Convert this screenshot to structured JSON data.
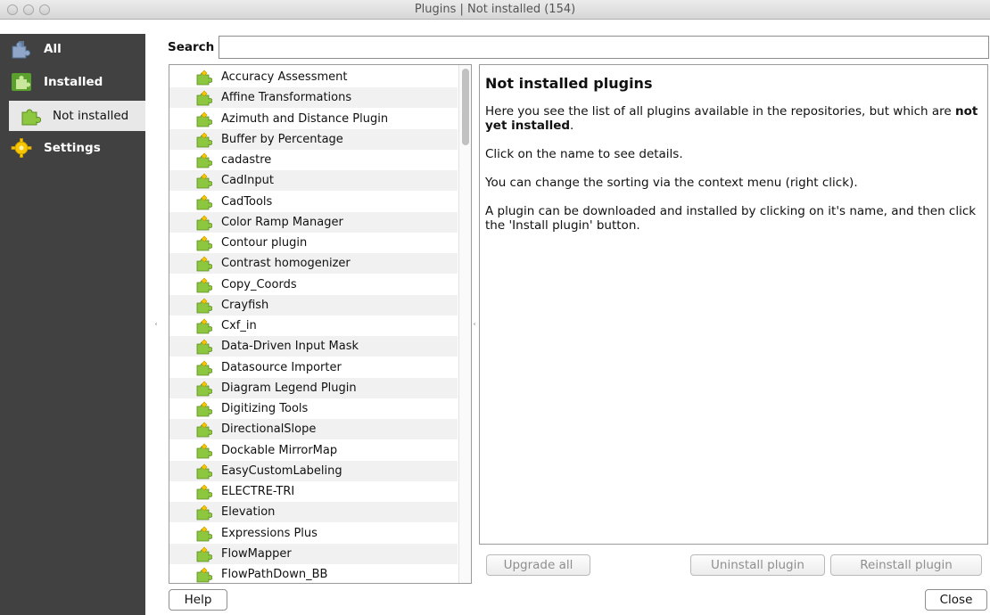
{
  "window": {
    "title": "Plugins | Not installed (154)"
  },
  "sidebar": {
    "items": [
      {
        "label": "All",
        "icon": "puzzle-gray-icon"
      },
      {
        "label": "Installed",
        "icon": "puzzle-green-icon"
      },
      {
        "label": "Not installed",
        "icon": "puzzle-green-icon",
        "selected": true
      },
      {
        "label": "Settings",
        "icon": "gear-icon"
      }
    ]
  },
  "search": {
    "label": "Search",
    "value": ""
  },
  "plugins": [
    "Accuracy Assessment",
    "Affine Transformations",
    "Azimuth and Distance Plugin",
    "Buffer by Percentage",
    "cadastre",
    "CadInput",
    "CadTools",
    "Color Ramp Manager",
    "Contour plugin",
    "Contrast homogenizer",
    "Copy_Coords",
    "Crayfish",
    "Cxf_in",
    "Data-Driven Input Mask",
    "Datasource Importer",
    "Diagram Legend Plugin",
    "Digitizing Tools",
    "DirectionalSlope",
    "Dockable MirrorMap",
    "EasyCustomLabeling",
    "ELECTRE-TRI",
    "Elevation",
    "Expressions Plus",
    "FlowMapper",
    "FlowPathDown_BB"
  ],
  "details": {
    "heading": "Not installed plugins",
    "p1_start": "Here you see the list of all plugins available in the repositories, but which are ",
    "p1_bold": "not yet installed",
    "p1_end": ".",
    "p2": "Click on the name to see details.",
    "p3": "You can change the sorting via the context menu (right click).",
    "p4": "A plugin can be downloaded and installed by clicking on it's name, and then click the 'Install plugin' button."
  },
  "buttons": {
    "upgrade_all": "Upgrade all",
    "uninstall": "Uninstall plugin",
    "reinstall": "Reinstall plugin",
    "help": "Help",
    "close": "Close"
  },
  "colors": {
    "sidebar_bg": "#414141",
    "puzzle_green": "#8dc63f",
    "puzzle_yellow": "#f7c600"
  }
}
